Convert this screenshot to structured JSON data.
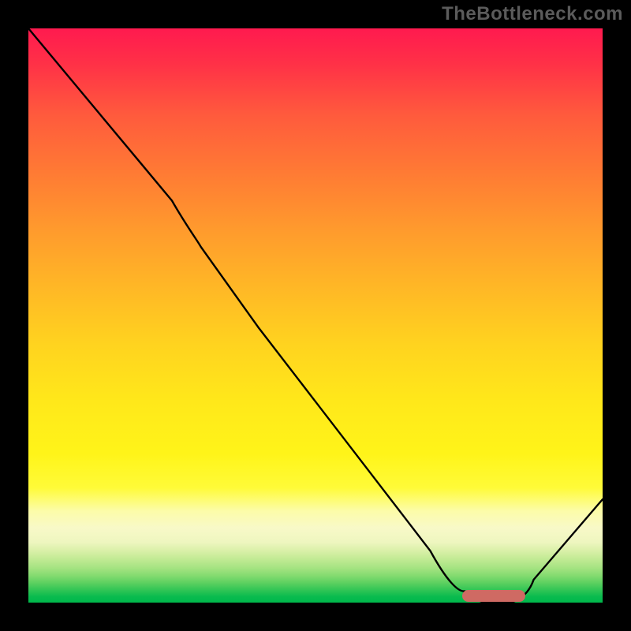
{
  "watermark": "TheBottleneck.com",
  "colors": {
    "top": "#ff1a4f",
    "mid": "#ffe81a",
    "bottom": "#00b84c",
    "curve": "#000000",
    "marker": "#cf6a63",
    "background": "#000000"
  },
  "chart_data": {
    "type": "line",
    "title": "",
    "xlabel": "",
    "ylabel": "",
    "xlim": [
      0,
      100
    ],
    "ylim": [
      0,
      100
    ],
    "grid": false,
    "legend": false,
    "series": [
      {
        "name": "curve",
        "x": [
          0,
          10,
          20,
          25,
          30,
          40,
          50,
          60,
          70,
          76,
          80,
          84,
          88,
          100
        ],
        "y": [
          100,
          88,
          76,
          70,
          62,
          48,
          35,
          22,
          9,
          2,
          0,
          0,
          4,
          18
        ]
      }
    ],
    "marker": {
      "name": "optimal-range",
      "x_start": 76,
      "x_end": 86,
      "y": 0,
      "shape": "rounded-bar"
    },
    "gradient_stops": [
      {
        "pos": 0.0,
        "color": "#ff1a4f"
      },
      {
        "pos": 0.35,
        "color": "#ff9a2d"
      },
      {
        "pos": 0.65,
        "color": "#ffe81a"
      },
      {
        "pos": 0.84,
        "color": "#fcfca8"
      },
      {
        "pos": 0.92,
        "color": "#c0ea93"
      },
      {
        "pos": 1.0,
        "color": "#00b84c"
      }
    ]
  }
}
